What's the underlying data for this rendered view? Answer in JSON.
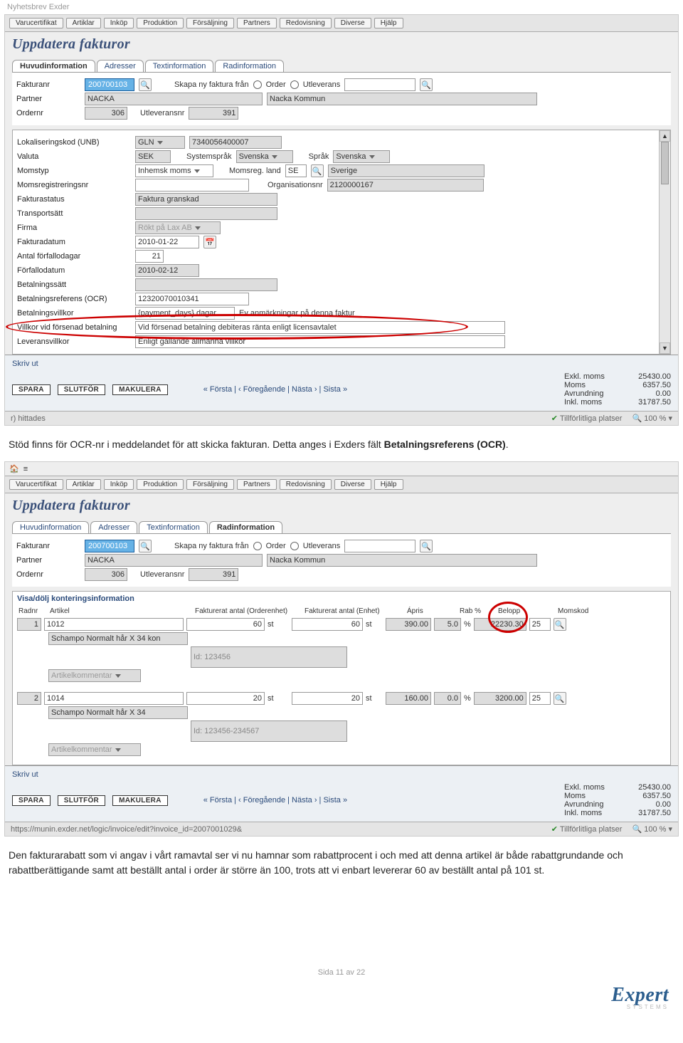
{
  "doc": {
    "header": "Nyhetsbrev Exder",
    "footer": "Sida 11 av 22",
    "logo": "Expert",
    "logo_sub": "SYSTEMS"
  },
  "menus": [
    "Varucertifikat",
    "Artiklar",
    "Inköp",
    "Produktion",
    "Försäljning",
    "Partners",
    "Redovisning",
    "Diverse",
    "Hjälp"
  ],
  "title": "Uppdatera fakturor",
  "tabs": {
    "huvud": "Huvudinformation",
    "adresser": "Adresser",
    "textinfo": "Textinformation",
    "radinfo": "Radinformation"
  },
  "topform": {
    "fakturanr_label": "Fakturanr",
    "fakturanr": "200700103",
    "skapa_label": "Skapa ny faktura från",
    "order_label": "Order",
    "utlev_label": "Utleverans",
    "partner_label": "Partner",
    "partner_code": "NACKA",
    "partner_name": "Nacka Kommun",
    "ordernr_label": "Ordernr",
    "ordernr": "306",
    "utleveransnr_label": "Utleveransnr",
    "utleveransnr": "391"
  },
  "details": {
    "lokalkod_label": "Lokaliseringskod (UNB)",
    "lokalkod_sel": "GLN",
    "lokalkod_val": "7340056400007",
    "valuta_label": "Valuta",
    "valuta": "SEK",
    "systemsprak_label": "Systemspråk",
    "systemsprak": "Svenska",
    "sprak_label": "Språk",
    "sprak": "Svenska",
    "momstyp_label": "Momstyp",
    "momstyp": "Inhemsk moms",
    "momsreg_land_label": "Momsreg. land",
    "momsreg_land_code": "SE",
    "momsreg_land_name": "Sverige",
    "momsreg_nr_label": "Momsregistreringsnr",
    "orgnr_label": "Organisationsnr",
    "orgnr": "2120000167",
    "fakturastatus_label": "Fakturastatus",
    "fakturastatus": "Faktura granskad",
    "transportsatt_label": "Transportsätt",
    "firma_label": "Firma",
    "firma": "Rökt på Lax AB",
    "fakturadatum_label": "Fakturadatum",
    "fakturadatum": "2010-01-22",
    "antal_forf_label": "Antal förfallodagar",
    "antal_forf": "21",
    "forfallodatum_label": "Förfallodatum",
    "forfallodatum": "2010-02-12",
    "betalningssatt_label": "Betalningssätt",
    "ocr_label": "Betalningsreferens (OCR)",
    "ocr": "12320070010341",
    "betalningsvillkor_label": "Betalningsvillkor",
    "betalningsvillkor": "{payment_days} dagar",
    "anmark_label": "Ev anmärkningar på denna faktur",
    "villkor_forsenad_label": "Villkor vid försenad betalning",
    "villkor_forsenad": "Vid försenad betalning debiteras ränta enligt licensavtalet",
    "leveransvillkor_label": "Leveransvillkor",
    "leveransvillkor": "Enligt gällande allmänna villkor"
  },
  "footbar": {
    "skriv": "Skriv ut",
    "spara": "SPARA",
    "slutfor": "SLUTFÖR",
    "makulera": "MAKULERA",
    "pager": "« Första | ‹ Föregående | Nästa › | Sista »"
  },
  "totals": {
    "l1": "Exkl. moms",
    "v1": "25430.00",
    "l2": "Moms",
    "v2": "6357.50",
    "l3": "Avrundning",
    "v3": "0.00",
    "l4": "Inkl. moms",
    "v4": "31787.50"
  },
  "status": {
    "left": "r) hittades",
    "trust": "Tillförlitliga platser",
    "zoom": "100 %"
  },
  "text1a": "Stöd finns för OCR-nr i meddelandet för att skicka fakturan. Detta anges i Exders fält ",
  "text1b": "Betalningsreferens (OCR)",
  "text1c": ".",
  "img2": {
    "visa_dolj": "Visa/dölj konteringsinformation",
    "headers": {
      "radnr": "Radnr",
      "artikel": "Artikel",
      "fa_orderenhet": "Fakturerat antal (Orderenhet)",
      "fa_enhet": "Fakturerat antal (Enhet)",
      "apris": "Ápris",
      "rab": "Rab %",
      "belopp": "Belopp",
      "momskod": "Momskod"
    },
    "rows": [
      {
        "radnr": "1",
        "artikel": "1012",
        "desc": "Schampo Normalt hår X 34 kon",
        "fa_order": "60",
        "unit1": "st",
        "fa_enhet": "60",
        "unit2": "st",
        "apris": "390.00",
        "rab": "5.0",
        "rabunit": "%",
        "belopp": "22230.30",
        "momskod": "25",
        "id": "Id: 123456",
        "komm": "Artikelkommentar"
      },
      {
        "radnr": "2",
        "artikel": "1014",
        "desc": "Schampo Normalt hår X 34",
        "fa_order": "20",
        "unit1": "st",
        "fa_enhet": "20",
        "unit2": "st",
        "apris": "160.00",
        "rab": "0.0",
        "rabunit": "%",
        "belopp": "3200.00",
        "momskod": "25",
        "id": "Id: 123456-234567",
        "komm": "Artikelkommentar"
      }
    ],
    "status_url": "https://munin.exder.net/logic/invoice/edit?invoice_id=2007001029&"
  },
  "text2": "Den fakturarabatt som vi angav i vårt ramavtal ser vi nu hamnar som rabattprocent i och med att denna artikel är både rabattgrundande och rabattberättigande samt att beställt antal i order är större än 100, trots att vi enbart levererar 60 av beställt antal på 101 st."
}
